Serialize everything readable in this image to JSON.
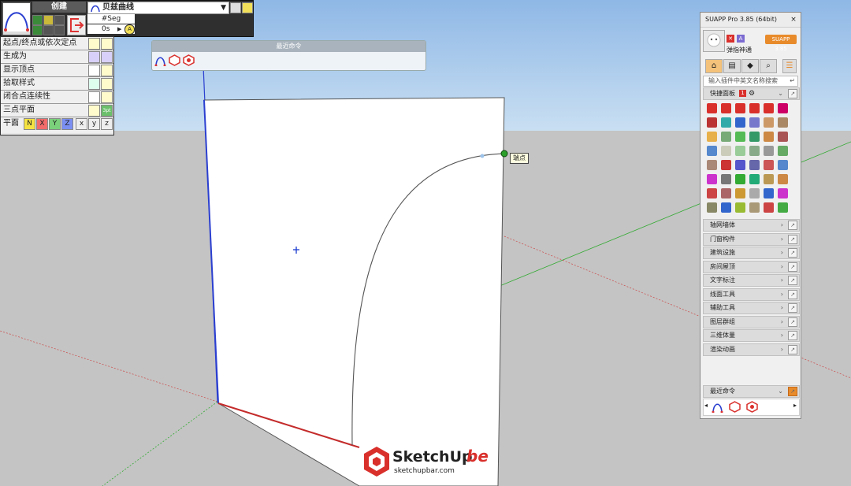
{
  "toolbar": {
    "create_label": "创建",
    "curve_type": "贝兹曲线",
    "seg_label": "#Seg",
    "seg_value": "0s",
    "auto_badge": "A"
  },
  "options": {
    "rows": [
      {
        "label": "起点/终点或依次定点"
      },
      {
        "label": "生成为"
      },
      {
        "label": "显示顶点"
      },
      {
        "label": "拾取样式"
      },
      {
        "label": "闭合点连续性"
      },
      {
        "label": "三点平面"
      },
      {
        "label": "平面"
      }
    ],
    "plane_axes": [
      "N",
      "X",
      "Y",
      "Z",
      "x",
      "y",
      "z"
    ],
    "three_pt_badge": "3pt"
  },
  "recent_panel": {
    "title": "最近命令"
  },
  "viewport": {
    "anchor_tooltip": "端点"
  },
  "suapp": {
    "title": "SUAPP Pro 3.85 (64bit)",
    "close": "×",
    "username": "弹指神通",
    "version_badge": "SUAPP 3.85",
    "search_placeholder": "输入插件中英文名称搜索",
    "quick_panel": "快捷面板",
    "quick_badge": "1",
    "sections": [
      "轴网墙体",
      "门窗构件",
      "建筑设施",
      "房间屋顶",
      "文字标注",
      "线面工具",
      "辅助工具",
      "图层群组",
      "三维体量",
      "渲染动画"
    ],
    "recent_commands": "最近命令"
  },
  "watermark": {
    "brand": "SketchUp",
    "suffix": "be",
    "url": "sketchupbar.com"
  },
  "colors": {
    "sky": "#a9cbee",
    "ground": "#c4c4c4",
    "face": "#ffffff",
    "accent_orange": "#e88b2b",
    "suapp_red": "#d9302c"
  }
}
